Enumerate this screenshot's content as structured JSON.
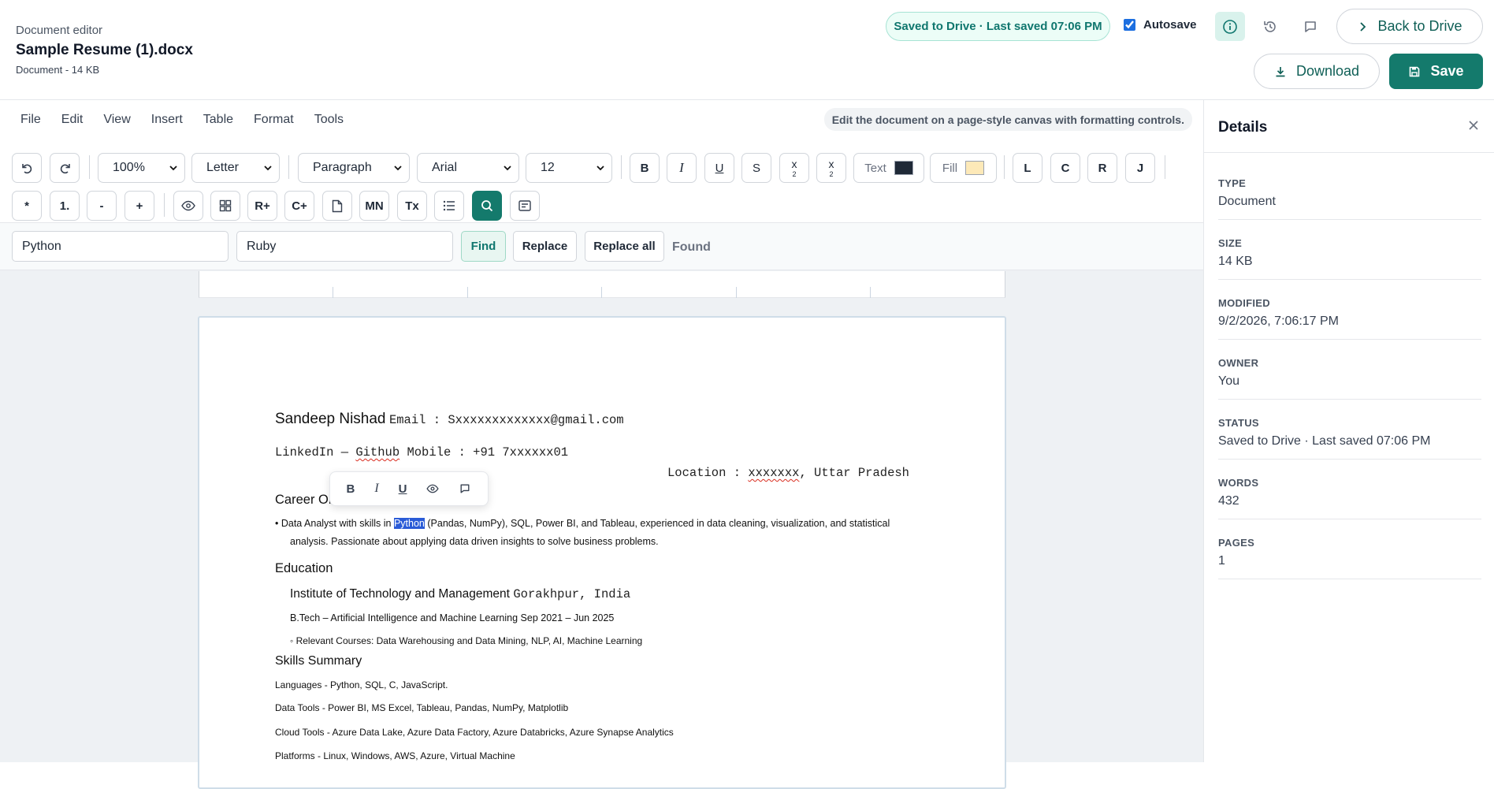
{
  "header": {
    "app_label": "Document editor",
    "doc_title": "Sample Resume (1).docx",
    "doc_meta": "Document - 14 KB",
    "status": "Saved to Drive · Last saved 07:06 PM",
    "autosave_label": "Autosave",
    "autosave_checked": true,
    "back_label": "Back to Drive",
    "download_label": "Download",
    "save_label": "Save"
  },
  "menu": [
    "File",
    "Edit",
    "View",
    "Insert",
    "Table",
    "Format",
    "Tools"
  ],
  "hint": "Edit the document on a page-style canvas with formatting controls.",
  "toolbar": {
    "zoom": "100%",
    "page_size": "Letter",
    "block_style": "Paragraph",
    "font": "Arial",
    "font_size": "12",
    "bold": "B",
    "italic": "I",
    "underline": "U",
    "strike": "S",
    "sup_x": "x",
    "sup_2": "2",
    "sub_x": "x",
    "sub_2": "2",
    "text_color_label": "Text",
    "text_color": "#1f2937",
    "fill_label": "Fill",
    "fill_color": "#fde9b8",
    "align_left": "L",
    "align_center": "C",
    "align_right": "R",
    "align_justify": "J",
    "bullet": "*",
    "numbered": "1.",
    "outdent": "-",
    "indent": "+",
    "insert_row": "R+",
    "insert_col": "C+",
    "mono": "MN",
    "clear_format": "Tx"
  },
  "find": {
    "find_value": "Python",
    "replace_value": "Ruby",
    "find_label": "Find",
    "replace_label": "Replace",
    "replace_all_label": "Replace all",
    "status": "Found"
  },
  "doc": {
    "name": "Sandeep Nishad",
    "email": "Email : Sxxxxxxxxxxxxx@gmail.com",
    "linkedin": "LinkedIn —",
    "github": "Github",
    "mobile": "Mobile : +91 7xxxxxx01",
    "location_prefix": "Location :",
    "location_city": "xxxxxxx",
    "location_suffix": ", Uttar Pradesh",
    "career_heading": "Career Ob",
    "career_line1_pre": "• Data Analyst with skills in ",
    "career_highlight": "Python",
    "career_line1_post": " (Pandas, NumPy), SQL, Power BI, and Tableau, experienced in data cleaning, visualization, and statistical",
    "career_line2": "analysis. Passionate about applying data driven insights to solve business problems.",
    "education_heading": "Education",
    "institute": "Institute of Technology and Management",
    "institute_loc": "Gorakhpur, India",
    "degree": "B.Tech – Artificial Intelligence and Machine Learning Sep 2021 – Jun 2025",
    "courses": "◦ Relevant Courses: Data Warehousing and Data Mining, NLP, AI, Machine Learning",
    "skills_heading": "Skills Summary",
    "languages": "Languages - Python, SQL, C, JavaScript.",
    "data_tools": "Data Tools - Power BI, MS Excel, Tableau, Pandas, NumPy, Matplotlib",
    "cloud_tools": "Cloud Tools - Azure Data Lake, Azure Data Factory, Azure Databricks, Azure Synapse Analytics",
    "platforms": "Platforms - Linux, Windows, AWS, Azure, Virtual Machine"
  },
  "popover": {
    "bold": "B",
    "italic": "I",
    "underline": "U"
  },
  "details": {
    "title": "Details",
    "rows": [
      {
        "label": "TYPE",
        "value": "Document"
      },
      {
        "label": "SIZE",
        "value": "14 KB"
      },
      {
        "label": "MODIFIED",
        "value": "9/2/2026, 7:06:17 PM"
      },
      {
        "label": "OWNER",
        "value": "You"
      },
      {
        "label": "STATUS",
        "value": "Saved to Drive · Last saved 07:06 PM"
      },
      {
        "label": "WORDS",
        "value": "432"
      },
      {
        "label": "PAGES",
        "value": "1"
      }
    ]
  }
}
